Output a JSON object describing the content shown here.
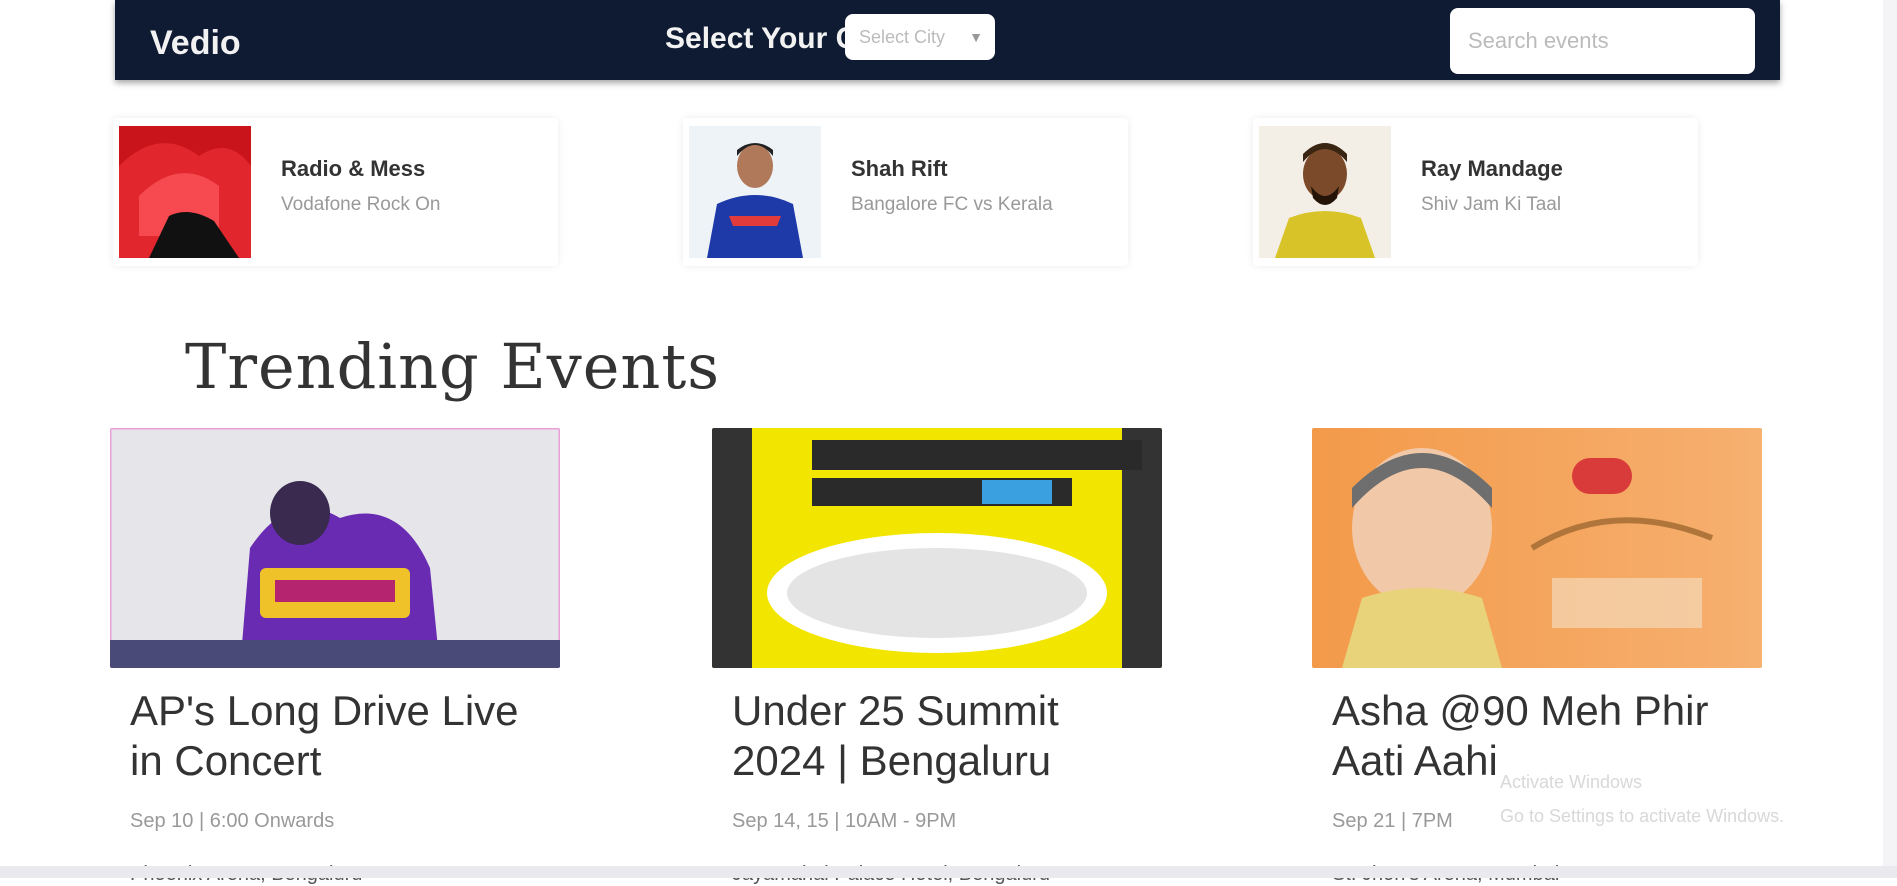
{
  "nav": {
    "logo": "Vedio",
    "city_label": "Select Your City",
    "city_value": "Select City",
    "search_placeholder": "Search events"
  },
  "artists": [
    {
      "name": "Radio & Mess",
      "sub": "Vodafone Rock On"
    },
    {
      "name": "Shah Rift",
      "sub": "Bangalore FC vs Kerala"
    },
    {
      "name": "Ray Mandage",
      "sub": "Shiv Jam Ki Taal"
    }
  ],
  "section_title": "Trending Events",
  "events": [
    {
      "title": "AP's Long Drive Live in Concert",
      "date": "Sep 10 | 6:00 Onwards",
      "venue": "Phoenix Arena, Bengaluru"
    },
    {
      "title": "Under 25 Summit 2024 | Bengaluru",
      "date": "Sep 14, 15 | 10AM - 9PM",
      "venue": "Jayamahal Palace Hotel, Bengaluru"
    },
    {
      "title": "Asha @90 Meh Phir Aati Aahi",
      "date": "Sep 21 | 7PM",
      "venue": "St. Jhon's Arena, Mumbai"
    }
  ],
  "toast": {
    "line1": "Activate Windows",
    "line2": "Go to Settings to activate Windows."
  },
  "colors": {
    "nav_bg": "#0f1a33",
    "accent_purple": "#6a2bb3",
    "accent_yellow": "#f2e600",
    "accent_orange": "#f39a4a"
  }
}
